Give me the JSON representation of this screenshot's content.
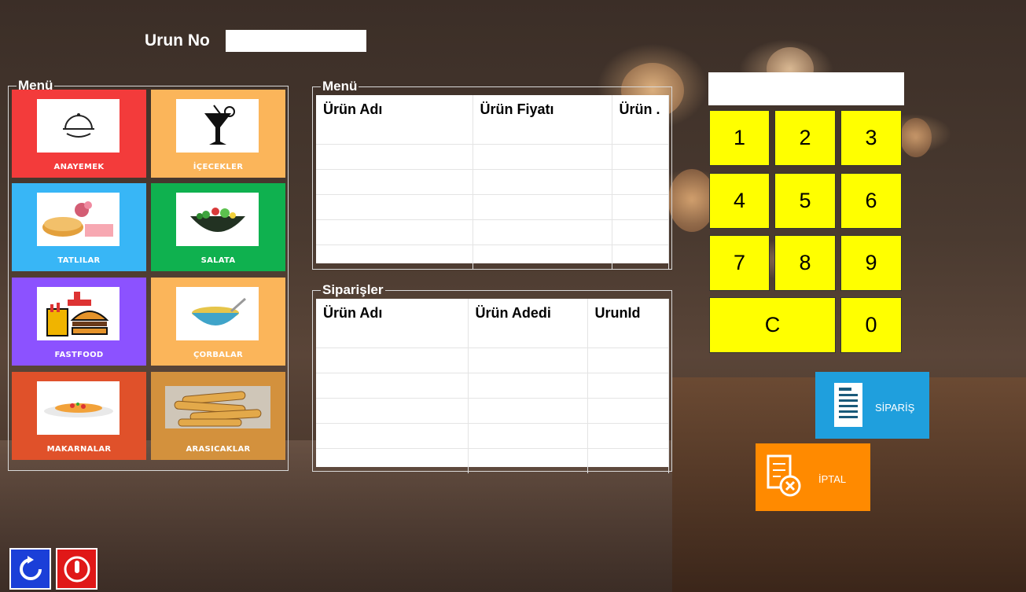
{
  "header": {
    "urun_no_label": "Urun No",
    "urun_no_value": ""
  },
  "menu_group": {
    "title": "Menü",
    "categories": [
      {
        "label": "ANAYEMEK",
        "icon": "serving-cloche-icon",
        "color": "#f33b3b"
      },
      {
        "label": "İÇECEKLER",
        "icon": "cocktail-glass-icon",
        "color": "#fbb55a"
      },
      {
        "label": "TATLILAR",
        "icon": "dessert-cake-icon",
        "color": "#38b6f6"
      },
      {
        "label": "SALATA",
        "icon": "salad-bowl-icon",
        "color": "#0fb14f"
      },
      {
        "label": "FASTFOOD",
        "icon": "fastfood-burger-icon",
        "color": "#8c52ff"
      },
      {
        "label": "ÇORBALAR",
        "icon": "soup-bowl-icon",
        "color": "#fbb55a"
      },
      {
        "label": "MAKARNALAR",
        "icon": "pasta-plate-icon",
        "color": "#e0512a"
      },
      {
        "label": "ARASICAKLAR",
        "icon": "borek-rolls-icon",
        "color": "#d3913d"
      }
    ]
  },
  "menu_table": {
    "title": "Menü",
    "columns": [
      "Ürün Adı",
      "Ürün Fiyatı",
      "Ürün ."
    ],
    "rows": [
      [
        "",
        "",
        ""
      ],
      [
        "",
        "",
        ""
      ],
      [
        "",
        "",
        ""
      ],
      [
        "",
        "",
        ""
      ],
      [
        "",
        "",
        ""
      ]
    ]
  },
  "orders_table": {
    "title": "Siparişler",
    "columns": [
      "Ürün Adı",
      "Ürün Adedi",
      "UrunId"
    ],
    "rows": [
      [
        "",
        "",
        ""
      ],
      [
        "",
        "",
        ""
      ],
      [
        "",
        "",
        ""
      ],
      [
        "",
        "",
        ""
      ],
      [
        "",
        "",
        ""
      ]
    ]
  },
  "keypad": {
    "display": "",
    "keys": [
      "1",
      "2",
      "3",
      "4",
      "5",
      "6",
      "7",
      "8",
      "9",
      "C",
      "0"
    ]
  },
  "actions": {
    "siparis_label": "SİPARİŞ",
    "iptal_label": "İPTAL",
    "refresh_icon": "refresh-icon",
    "power_icon": "power-icon"
  },
  "colors": {
    "key_yellow": "#ffff00",
    "siparis_blue": "#1f9fdd",
    "iptal_orange": "#ff8a00",
    "refresh_blue": "#1b3fd8",
    "power_red": "#e01818"
  }
}
